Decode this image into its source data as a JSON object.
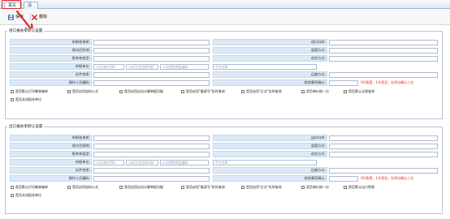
{
  "tabs": [
    {
      "label": "报关单"
    },
    {
      "label": "清单"
    }
  ],
  "toolbar": {
    "save_label": "保存",
    "delete_label": "删除"
  },
  "import_panel": {
    "title": "进口报关单默认设置",
    "left_fields": [
      {
        "label": "申报地海关:",
        "value": ""
      },
      {
        "label": "境内目的地:",
        "value": ""
      },
      {
        "label": "报关单类型:",
        "value": ""
      }
    ],
    "right_fields": [
      {
        "label": "进口口岸:",
        "value": ""
      },
      {
        "label": "监管方式:",
        "value": ""
      },
      {
        "label": "成交方式:",
        "value": ""
      }
    ],
    "unit_label": "申报单位:",
    "unit_placeholders": [
      "10位海关代码",
      "18位社会信用代码",
      "10位检验检疫编码",
      "中文名称"
    ],
    "cert_label": "证件性质:",
    "transport_label": "运输方式:",
    "operator_label": "操作人员编码:",
    "other_confirm_label": "其他事项确认:",
    "other_confirm_note": "0代表是，1代表否，在四位确认三位",
    "checkboxes": [
      "是否默认打印集装箱单",
      "是否启用加码公式",
      "是否启用自动计算单据功能",
      "是否启用\"备案号\"实时查询",
      "是否启用\"企业\"实时查询",
      "是否单价统一位",
      "是否默认无税查询",
      "是否关闭报关单位"
    ]
  },
  "export_panel": {
    "title": "出口报关单默认设置",
    "left_fields": [
      {
        "label": "申报地海关:",
        "value": ""
      },
      {
        "label": "境内货源地:",
        "value": ""
      },
      {
        "label": "报关单类型:",
        "value": ""
      }
    ],
    "right_fields": [
      {
        "label": "出口口岸:",
        "value": ""
      },
      {
        "label": "监管方式:",
        "value": ""
      },
      {
        "label": "成交方式:",
        "value": ""
      }
    ],
    "unit_label": "申报单位:",
    "unit_placeholders": [
      "10位海关代码",
      "18位社会信用代码",
      "10位检验检疫编码",
      "中文名称"
    ],
    "cert_label": "证件性质:",
    "transport_label": "运输方式:",
    "operator_label": "操作人员编码:",
    "other_confirm_label": "其他事项确认:",
    "other_confirm_note": "0代表是，1代表否，在四位确认三位",
    "checkboxes": [
      "是否默认打印集装箱单",
      "是否启用加码公式",
      "是否启用自动计算单据功能",
      "是否启用\"备案号\"实时查询",
      "是否启用\"企业\"实时查询",
      "是否单价统一位",
      "是否默认出口免税",
      "是否关闭报关单位"
    ]
  },
  "colors": {
    "accent_red": "#e21f26",
    "label_bg": "#dbe9f8",
    "note_red": "#e52222"
  }
}
